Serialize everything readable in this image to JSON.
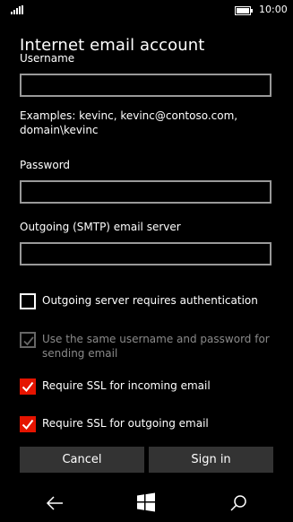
{
  "status": {
    "time": "10:00",
    "battery_level": 1.0
  },
  "title": "Internet email account",
  "username": {
    "label": "Username",
    "value": ""
  },
  "hint": "Examples: kevinc, kevinc@contoso.com, domain\\kevinc",
  "password": {
    "label": "Password",
    "value": ""
  },
  "smtp": {
    "label": "Outgoing (SMTP) email server",
    "value": ""
  },
  "checks": [
    {
      "label": "Outgoing server requires authentication",
      "state": "unchecked"
    },
    {
      "label": "Use the same username and password for sending email",
      "state": "disabled-checked"
    },
    {
      "label": "Require SSL for incoming email",
      "state": "checked"
    },
    {
      "label": "Require SSL for outgoing email",
      "state": "checked"
    }
  ],
  "buttons": {
    "cancel": "Cancel",
    "sign_in": "Sign in"
  },
  "colors": {
    "accent": "#e51400",
    "background": "#000000",
    "button": "#333333"
  },
  "nav_icons": [
    "back-icon",
    "windows-start-icon",
    "search-icon"
  ]
}
